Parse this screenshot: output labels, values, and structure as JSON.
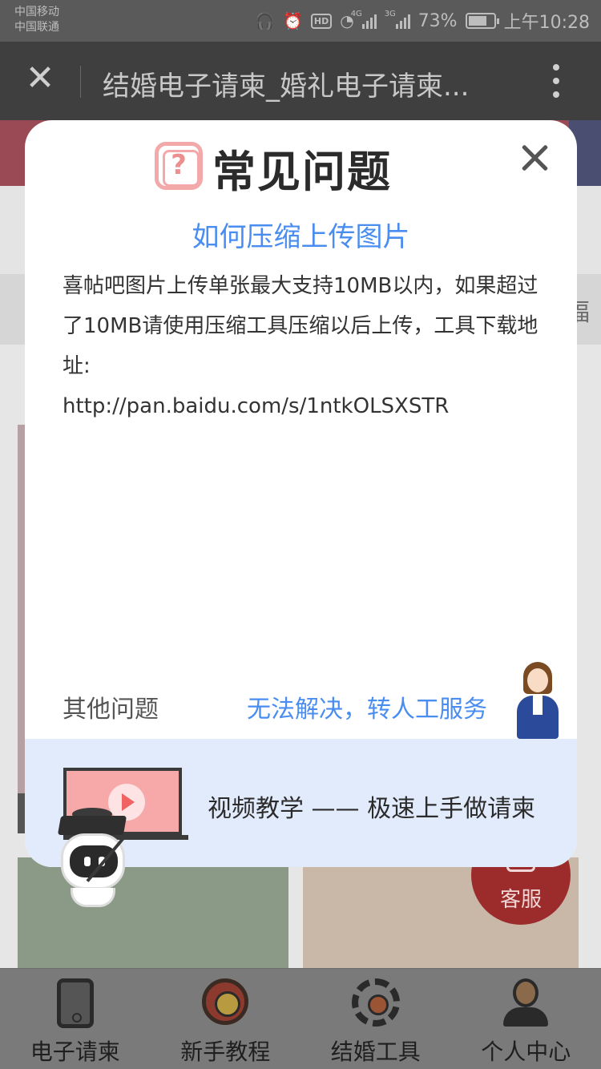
{
  "status_bar": {
    "carrier_1": "中国移动",
    "carrier_2": "中国联通",
    "battery_percent": "73%",
    "time": "上午10:28",
    "network_1": "4G",
    "network_2": "3G"
  },
  "browser": {
    "title": "结婚电子请柬_婚礼电子请柬..."
  },
  "background": {
    "edge_char": "福",
    "support_label": "客服"
  },
  "modal": {
    "title": "常见问题",
    "question_icon_glyph": "?",
    "question": "如何压缩上传图片",
    "answer_text": "喜帖吧图片上传单张最大支持10MB以内，如果超过了10MB请使用压缩工具压缩以后上传，工具下载地址:",
    "answer_url": "http://pan.baidu.com/s/1ntkOLSXSTR",
    "other_questions": "其他问题",
    "human_service": "无法解决，转人工服务",
    "video_tutorial": "视频教学 —— 极速上手做请柬"
  },
  "tabbar": {
    "items": [
      {
        "label": "电子请柬",
        "icon": "phone-icon"
      },
      {
        "label": "新手教程",
        "icon": "medal-icon"
      },
      {
        "label": "结婚工具",
        "icon": "gear-icon"
      },
      {
        "label": "个人中心",
        "icon": "person-icon"
      }
    ]
  },
  "colors": {
    "accent_blue": "#4a8df0",
    "question_icon_pink": "#f3a9a9",
    "footer_bg": "#e2ebfb"
  }
}
